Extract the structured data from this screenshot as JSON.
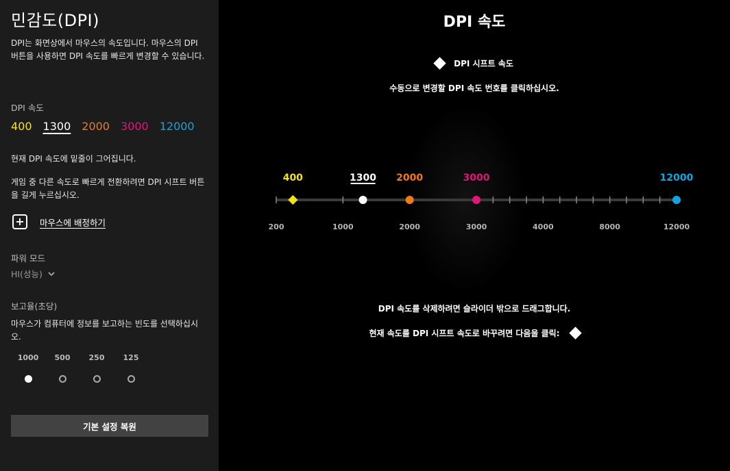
{
  "sidebar": {
    "title": "민감도(DPI)",
    "description": "DPI는 화면상에서 마우스의 속도입니다. 마우스의 DPI 버튼을 사용하면 DPI 속도를 빠르게 변경할 수 있습니다.",
    "dpi_speeds_label": "DPI 속도",
    "dpi_speeds": [
      {
        "value": "400",
        "color": "#f5e01a"
      },
      {
        "value": "1300",
        "color": "#ffffff",
        "current": true
      },
      {
        "value": "2000",
        "color": "#f07a1b"
      },
      {
        "value": "3000",
        "color": "#e0177a"
      },
      {
        "value": "12000",
        "color": "#11a5de"
      }
    ],
    "current_note": "현재 DPI 속도에 밑줄이 그어집니다.",
    "shift_note": "게임 중 다른 속도로 빠르게 전환하려면 DPI 시프트 버튼을 길게 누르십시오.",
    "assign_label": "마우스에 배정하기",
    "assign_icon": "plus-icon",
    "power_mode_label": "파워 모드",
    "power_mode_value": "HI(성능)",
    "report_rate_label": "보고율(초당)",
    "report_rate_description": "마우스가 컴퓨터에 정보를 보고하는 빈도를 선택하십시오.",
    "report_rates": [
      {
        "label": "1000",
        "selected": true
      },
      {
        "label": "500",
        "selected": false
      },
      {
        "label": "250",
        "selected": false
      },
      {
        "label": "125",
        "selected": false
      }
    ],
    "reset_label": "기본 설정 복원"
  },
  "main": {
    "title": "DPI 속도",
    "shift_legend": "DPI 시프트 속도",
    "instruction_click": "수동으로 변경할 DPI 속도 번호를 클릭하십시오.",
    "instruction_delete": "DPI 속도를 삭제하려면 슬라이더 밖으로 드래그합니다.",
    "instruction_set_shift": "현재 속도를 DPI 시프트 속도로 바꾸려면 다음을 클릭:",
    "slider": {
      "track_color": "#3a3a3a",
      "tick_labels": [
        "200",
        "1000",
        "2000",
        "3000",
        "4000",
        "8000",
        "12000"
      ],
      "markers": [
        {
          "value": "400",
          "color": "#f5e01a",
          "shape": "diamond",
          "shift": true
        },
        {
          "value": "1300",
          "color": "#ffffff",
          "shape": "circle",
          "current": true
        },
        {
          "value": "2000",
          "color": "#f07a1b",
          "shape": "circle"
        },
        {
          "value": "3000",
          "color": "#e0177a",
          "shape": "circle"
        },
        {
          "value": "12000",
          "color": "#11a5de",
          "shape": "circle"
        }
      ]
    }
  }
}
